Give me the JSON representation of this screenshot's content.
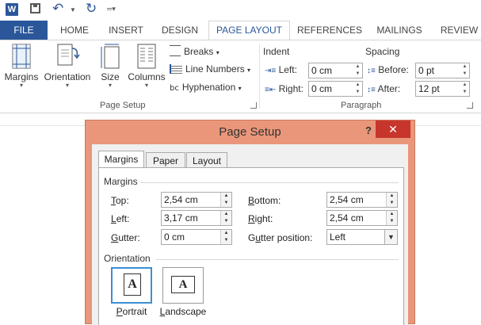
{
  "app": {
    "logo_letter": "W"
  },
  "tabs": [
    {
      "label": "FILE"
    },
    {
      "label": "HOME"
    },
    {
      "label": "INSERT"
    },
    {
      "label": "DESIGN"
    },
    {
      "label": "PAGE LAYOUT"
    },
    {
      "label": "REFERENCES"
    },
    {
      "label": "MAILINGS"
    },
    {
      "label": "REVIEW"
    }
  ],
  "ribbon": {
    "page_setup": {
      "margins": "Margins",
      "orientation": "Orientation",
      "size": "Size",
      "columns": "Columns",
      "breaks": "Breaks",
      "line_numbers": "Line Numbers",
      "hyphenation": "Hyphenation",
      "group_label": "Page Setup"
    },
    "paragraph": {
      "indent": "Indent",
      "spacing": "Spacing",
      "left_label": "Left:",
      "left_value": "0 cm",
      "right_label": "Right:",
      "right_value": "0 cm",
      "before_label": "Before:",
      "before_value": "0 pt",
      "after_label": "After:",
      "after_value": "12 pt",
      "group_label": "Paragraph"
    }
  },
  "dialog": {
    "title": "Page Setup",
    "help": "?",
    "close": "✕",
    "tabs": [
      "Margins",
      "Paper",
      "Layout"
    ],
    "margins_section": "Margins",
    "top_label": "Top:",
    "top_value": "2,54 cm",
    "bottom_label": "Bottom:",
    "bottom_value": "2,54 cm",
    "left_label": "Left:",
    "left_value": "3,17 cm",
    "right_label": "Right:",
    "right_value": "2,54 cm",
    "gutter_label": "Gutter:",
    "gutter_value": "0 cm",
    "gutter_position_label": "Gutter position:",
    "gutter_position_value": "Left",
    "orientation_section": "Orientation",
    "portrait": "Portrait",
    "landscape": "Landscape",
    "orientation_glyph": "A"
  },
  "colors": {
    "brand": "#2b579a",
    "dialog_frame": "#e9967a",
    "close_button": "#c7362c",
    "selection": "#3b8fd6"
  }
}
